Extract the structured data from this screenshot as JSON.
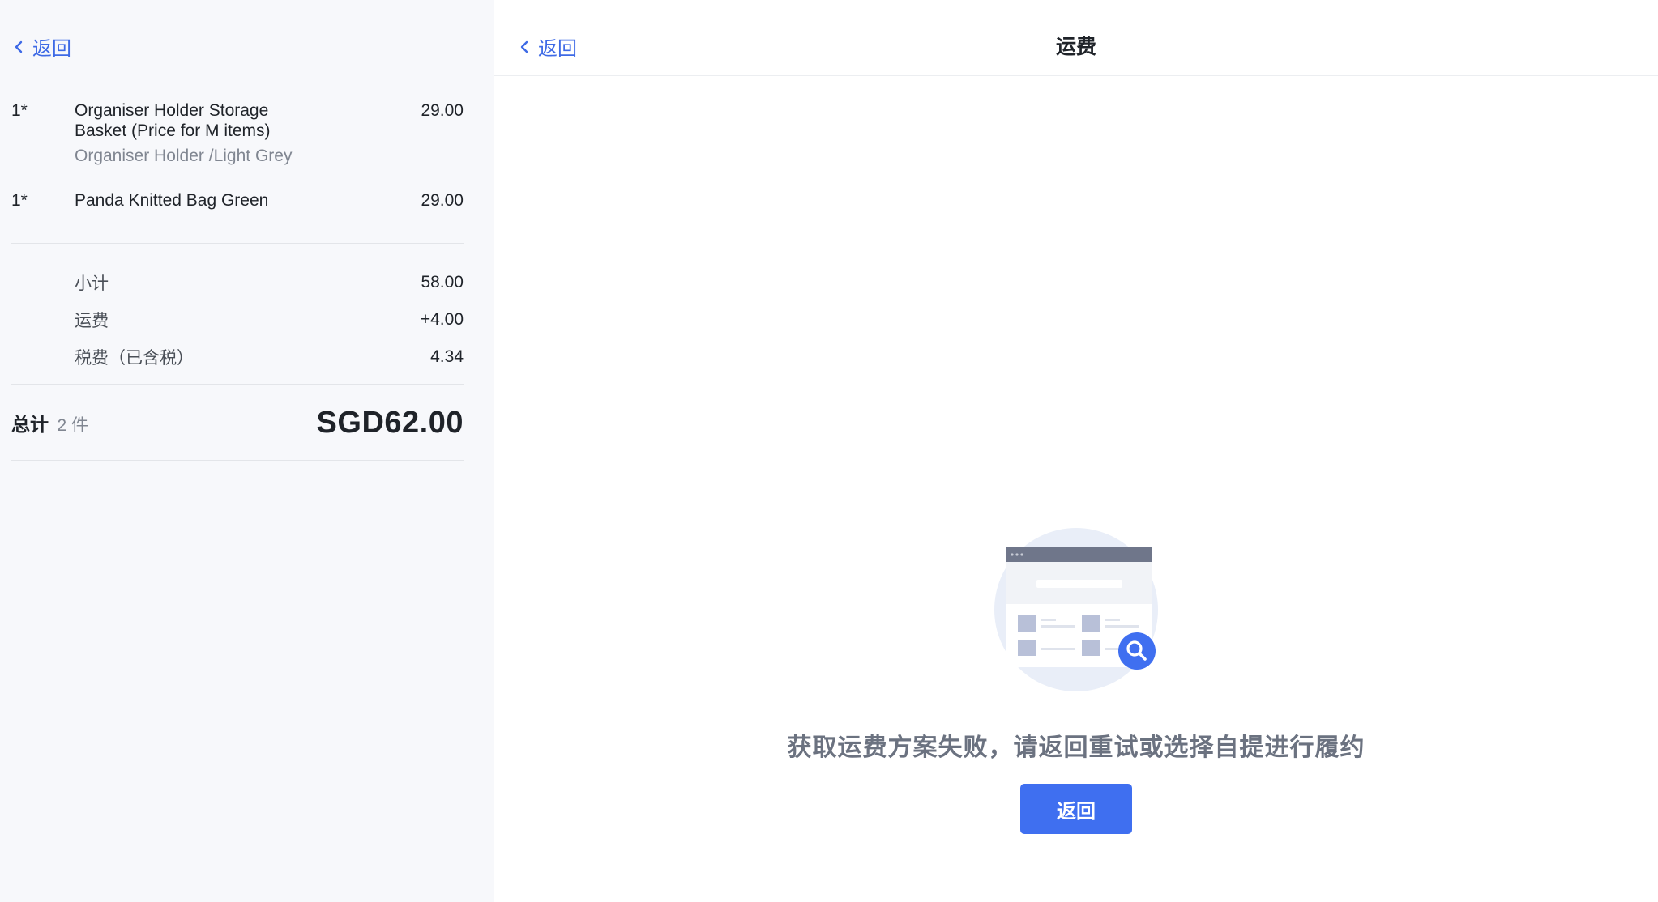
{
  "left": {
    "back_label": "返回",
    "items": [
      {
        "qty": "1*",
        "name": "Organiser Holder Storage Basket (Price for M items)",
        "variant": "Organiser Holder /Light Grey",
        "price": "29.00"
      },
      {
        "qty": "1*",
        "name": "Panda Knitted Bag Green",
        "variant": "",
        "price": "29.00"
      }
    ],
    "summary": [
      {
        "label": "小计",
        "value": "58.00"
      },
      {
        "label": "运费",
        "value": "+4.00"
      },
      {
        "label": "税费（已含税）",
        "value": "4.34"
      }
    ],
    "total": {
      "label": "总计",
      "count": "2 件",
      "value": "SGD62.00"
    }
  },
  "right": {
    "back_label": "返回",
    "title": "运费",
    "empty_message": "获取运费方案失败，请返回重试或选择自提进行履约",
    "button_label": "返回"
  },
  "colors": {
    "accent": "#3f6ff0",
    "link": "#3e6ae6",
    "panel_bg": "#f7f8fb"
  },
  "icons": {
    "back": "chevron-left-icon",
    "search": "search-icon"
  }
}
